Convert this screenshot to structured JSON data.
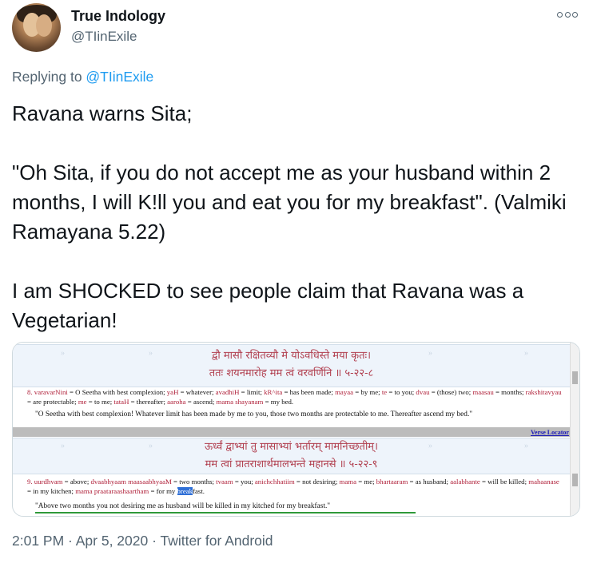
{
  "author": {
    "name": "True Indology",
    "handle": "@TIinExile"
  },
  "reply": {
    "prefix": "Replying to ",
    "to": "@TIinExile"
  },
  "tweet": {
    "line1": "Ravana warns Sita;",
    "line2": "\"Oh Sita, if you do not accept me as your husband within 2 months, I will K!ll you and eat you for my breakfast\". (Valmiki Ramayana 5.22)",
    "line3": "I am SHOCKED to see people claim that Ravana was a Vegetarian!"
  },
  "image": {
    "verse8_line1": "द्वौ मासौ रक्षितव्यौ मे योऽवधिस्ते मया कृतः।",
    "verse8_line2": "ततः शयनमारोह मम त्वं वरवर्णिनि ॥ ५-२२-८",
    "gloss8": [
      {
        "k": "8. varavarNini",
        "v": " = O Seetha with best complexion; "
      },
      {
        "k": "yaH",
        "v": " = whatever; "
      },
      {
        "k": "avadhiH",
        "v": " = limit; "
      },
      {
        "k": "kR^ita",
        "v": " = has been made; "
      },
      {
        "k": "mayaa",
        "v": " = by me; "
      },
      {
        "k": "te",
        "v": " = to you; "
      },
      {
        "k": "dvau",
        "v": " = (those) two; "
      },
      {
        "k": "maasau",
        "v": " = months; "
      },
      {
        "k": "rakshitavyau",
        "v": " = are protectable; "
      },
      {
        "k": "me",
        "v": " = to me; "
      },
      {
        "k": "tataH",
        "v": " = thereafter; "
      },
      {
        "k": "aaroha",
        "v": " = ascend; "
      },
      {
        "k": "mama shayanam",
        "v": " = my bed."
      }
    ],
    "trans8": "\"O Seetha with best complexion! Whatever limit has been made by me to you, those two months are protectable to me. Thereafter ascend my bed.\"",
    "locator": "Verse Locator",
    "verse9_line1": "ऊर्ध्वं द्वाभ्यां तु मासाभ्यां भर्तारम् मामनिच्छतीम्।",
    "verse9_line2": "मम त्वां प्रातराशार्थमालभन्ते महानसे ॥ ५-२२-९",
    "gloss9": [
      {
        "k": "9. uurdhvam",
        "v": " = above; "
      },
      {
        "k": "dvaabhyaam maasaabhyaaM",
        "v": " = two months; "
      },
      {
        "k": "tvaam",
        "v": " = you; "
      },
      {
        "k": "anichchhatiim",
        "v": " = not desiring; "
      },
      {
        "k": "mama",
        "v": " = me; "
      },
      {
        "k": "bhartaaram",
        "v": " = as husband; "
      },
      {
        "k": "aalabhante",
        "v": " = will be killed; "
      },
      {
        "k": "mahaanase",
        "v": " = in my kitchen; "
      },
      {
        "k": "mama praataraashaartham",
        "v": " = for my "
      }
    ],
    "gloss9_highlight": "break",
    "gloss9_tail": "fast.",
    "trans9": "\"Above two months you not desiring me as husband will be killed in my kitched for my breakfast.\"",
    "arrow_glyph": "»"
  },
  "footer": "2:01 PM · Apr 5, 2020 · Twitter for Android"
}
